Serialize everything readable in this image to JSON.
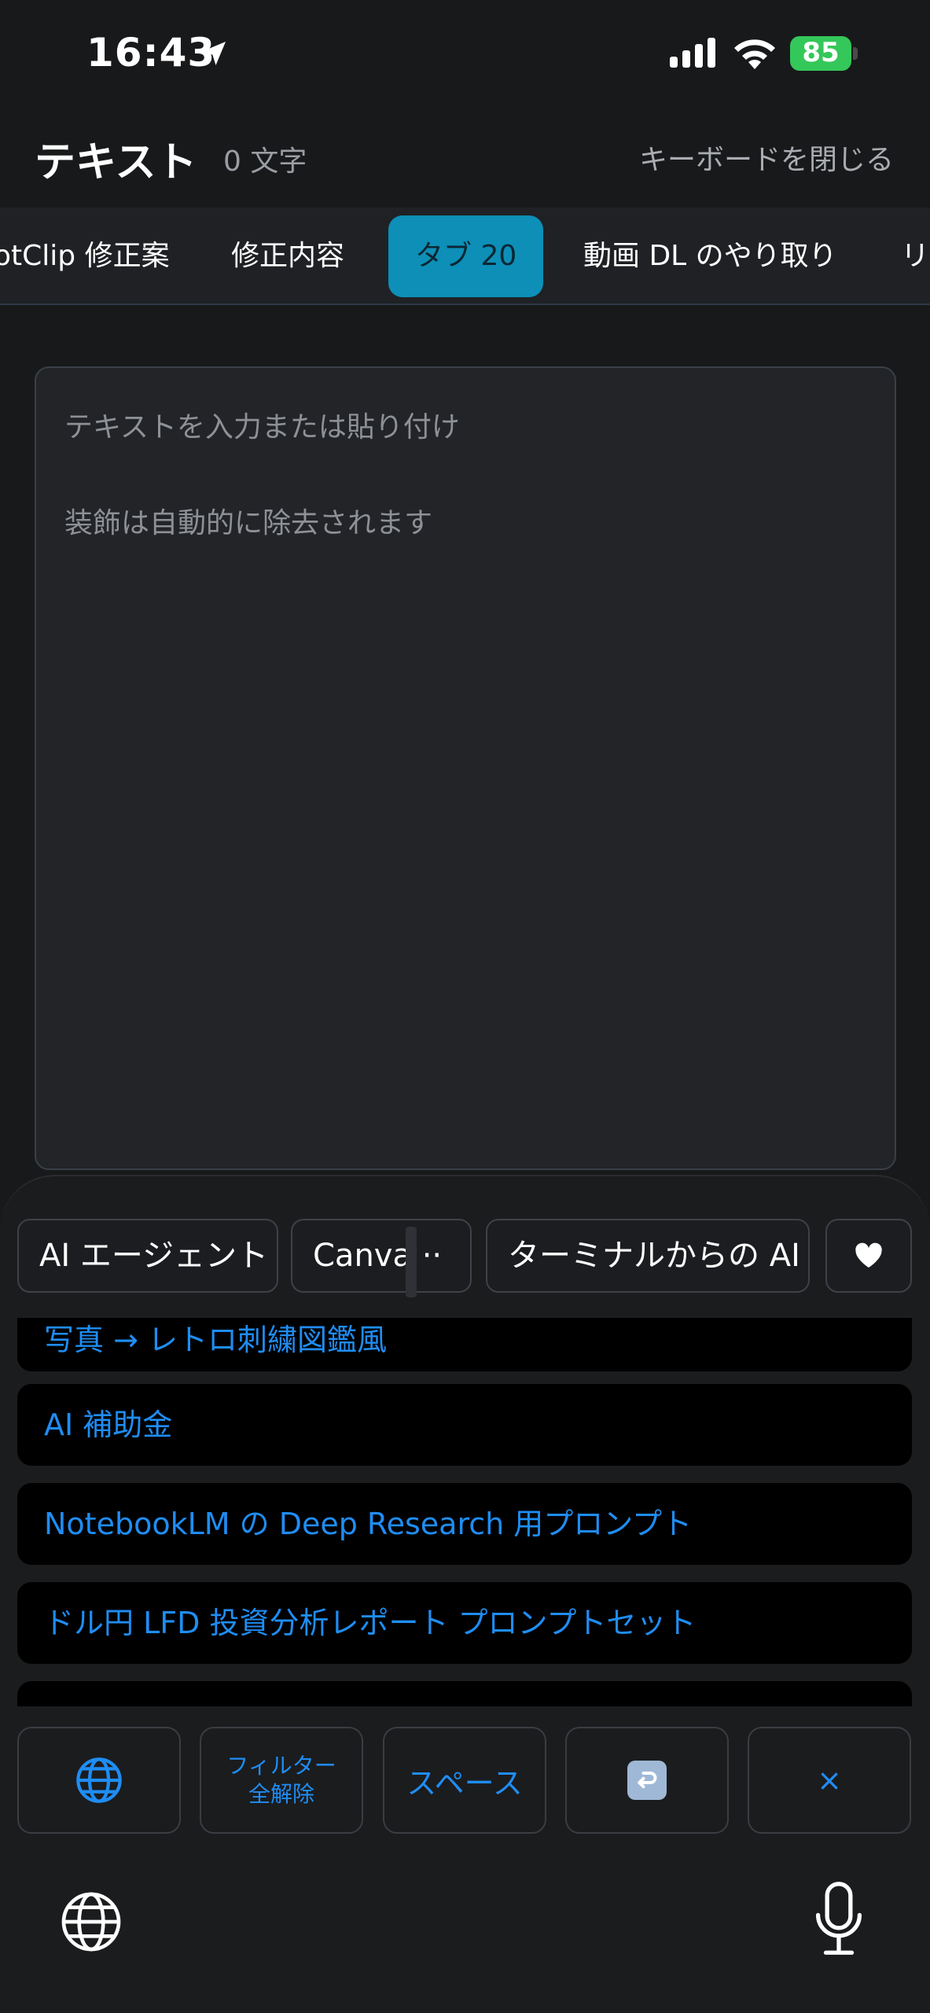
{
  "status_bar": {
    "time": "16:43",
    "battery": "85"
  },
  "header": {
    "title": "テキスト",
    "char_count": "0 文字",
    "close_keyboard": "キーボードを閉じる"
  },
  "tabs": [
    {
      "label": "otClip 修正案"
    },
    {
      "label": "修正内容"
    },
    {
      "label": "タブ 20",
      "active": true
    },
    {
      "label": "動画 DL のやり取り"
    },
    {
      "label": "リ"
    }
  ],
  "editor": {
    "placeholder_line1": "テキストを入力または貼り付け",
    "placeholder_line2": "装飾は自動的に除去されます"
  },
  "chips": [
    {
      "label": "AI エージェント"
    },
    {
      "label": "Canva ··"
    },
    {
      "label": "ターミナルからの AI コ"
    }
  ],
  "list": [
    {
      "label": "写真 → レトロ刺繍図鑑風"
    },
    {
      "label": "AI 補助金"
    },
    {
      "label": "NotebookLM の Deep Research 用プロンプト"
    },
    {
      "label": "ドル円 LFD 投資分析レポート プロンプトセット"
    }
  ],
  "keys": {
    "filter_line1": "フィルター",
    "filter_line2": "全解除",
    "space": "スペース",
    "delete": "×"
  },
  "icons": {
    "location": "location-arrow-icon",
    "signal": "signal-icon",
    "wifi": "wifi-icon",
    "heart": "heart-icon",
    "globe": "globe-icon",
    "enter": "return-icon",
    "mic": "microphone-icon"
  },
  "colors": {
    "accent": "#1f8df3",
    "active_tab": "#0d8fb7",
    "battery": "#34c759",
    "background": "#18191b"
  }
}
